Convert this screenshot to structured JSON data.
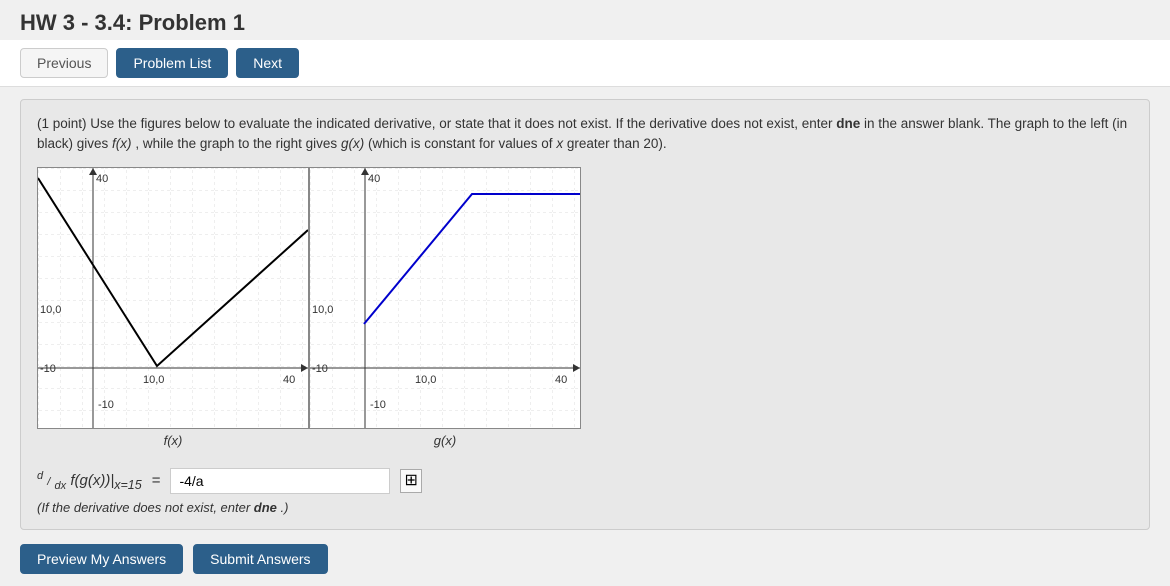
{
  "page": {
    "title": "HW 3 - 3.4: Problem 1"
  },
  "toolbar": {
    "previous_label": "Previous",
    "problem_list_label": "Problem List",
    "next_label": "Next"
  },
  "problem": {
    "points": "(1 point)",
    "description": "Use the figures below to evaluate the indicated derivative, or state that it does not exist. If the derivative does not exist, enter",
    "dne_word": "dne",
    "description2": "in the answer blank. The graph to the left (in black) gives",
    "fx_label": "f(x)",
    "desc_middle": ", while the graph to the right gives",
    "gx_label": "g(x)",
    "desc_end": "(which is constant for values of",
    "x_label": "x",
    "desc_end2": "greater than 20).",
    "graph_f_label": "f(x)",
    "graph_g_label": "g(x)",
    "formula_prefix": "d/dx",
    "formula_body": "f(g(x))|",
    "formula_subscript": "x=15",
    "formula_equals": "=",
    "input_value": "-4/a",
    "hint_text": "(If the derivative does not exist, enter",
    "hint_dne": "dne",
    "hint_end": ".)"
  },
  "actions": {
    "preview_label": "Preview My Answers",
    "submit_label": "Submit Answers"
  },
  "graph_f": {
    "x_min": -10,
    "x_max": 40,
    "y_min": -10,
    "y_max": 40,
    "axis_labels": {
      "top": "40",
      "mid_y": "10,0",
      "x_neg": "-10",
      "x_label_left": "-10",
      "x_mid": "10,0",
      "x_right": "40",
      "y_neg": "-10"
    }
  },
  "graph_g": {
    "x_min": -10,
    "x_max": 40,
    "y_min": -10,
    "y_max": 40,
    "axis_labels": {
      "top": "40",
      "mid_y": "10,0",
      "x_neg": "-10",
      "x_label_left": "-10",
      "x_mid": "10,0",
      "x_right": "40",
      "y_neg": "-10"
    }
  },
  "colors": {
    "primary_button": "#2c5f8a",
    "graph_f_line": "#000000",
    "graph_g_line": "#0000dd"
  }
}
